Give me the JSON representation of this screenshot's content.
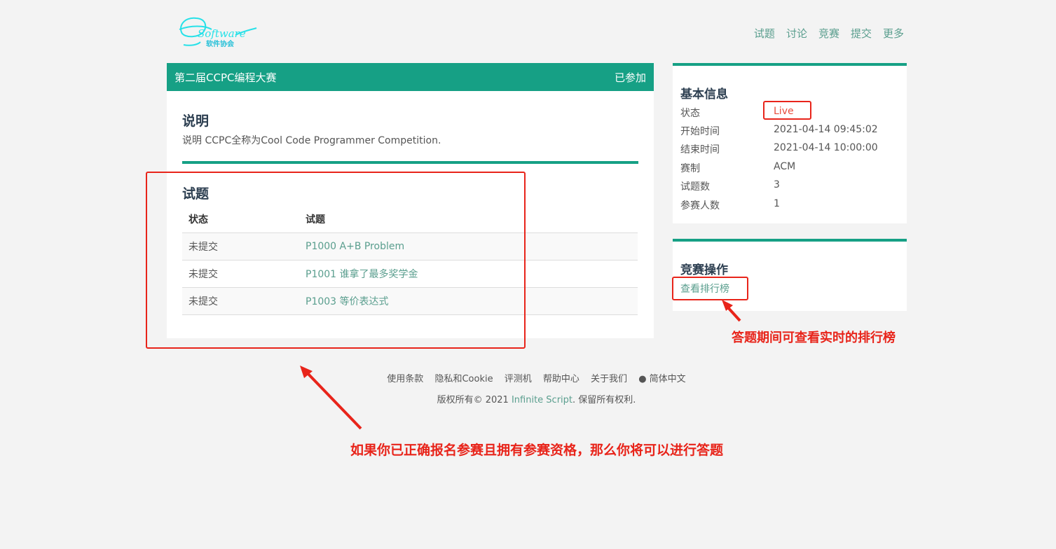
{
  "logo": {
    "text_top": "Software",
    "text_bottom": "软件协会"
  },
  "nav": {
    "items": [
      "试题",
      "讨论",
      "竞赛",
      "提交",
      "更多"
    ]
  },
  "contest": {
    "title": "第二届CCPC编程大赛",
    "joined_label": "已参加",
    "description_heading": "说明",
    "description": "说明 CCPC全称为Cool Code Programmer Competition.",
    "problems_heading": "试题",
    "table": {
      "headers": [
        "状态",
        "试题"
      ],
      "rows": [
        {
          "status": "未提交",
          "problem": "P1000 A+B Problem"
        },
        {
          "status": "未提交",
          "problem": "P1001 谁拿了最多奖学金"
        },
        {
          "status": "未提交",
          "problem": "P1003 等价表达式"
        }
      ]
    }
  },
  "info": {
    "heading": "基本信息",
    "rows": [
      {
        "label": "状态",
        "value": "Live"
      },
      {
        "label": "开始时间",
        "value": "2021-04-14 09:45:02"
      },
      {
        "label": "结束时间",
        "value": "2021-04-14 10:00:00"
      },
      {
        "label": "赛制",
        "value": "ACM"
      },
      {
        "label": "试题数",
        "value": "3"
      },
      {
        "label": "参赛人数",
        "value": "1"
      }
    ]
  },
  "actions": {
    "heading": "竞赛操作",
    "rank_link": "查看排行榜"
  },
  "footer": {
    "links": [
      "使用条款",
      "隐私和Cookie",
      "评测机",
      "帮助中心",
      "关于我们"
    ],
    "language": "简体中文",
    "copyright_prefix": "版权所有© 2021 ",
    "company": "Infinite Script",
    "copyright_suffix": ". 保留所有权利."
  },
  "annotations": {
    "rank_note": "答题期间可查看实时的排行榜",
    "problems_note": "如果你已正确报名参赛且拥有参赛资格，那么你将可以进行答题"
  },
  "colors": {
    "accent": "#16a085",
    "link": "#5a9e8e",
    "live": "#e74c3c",
    "annotation": "#e8241a"
  }
}
